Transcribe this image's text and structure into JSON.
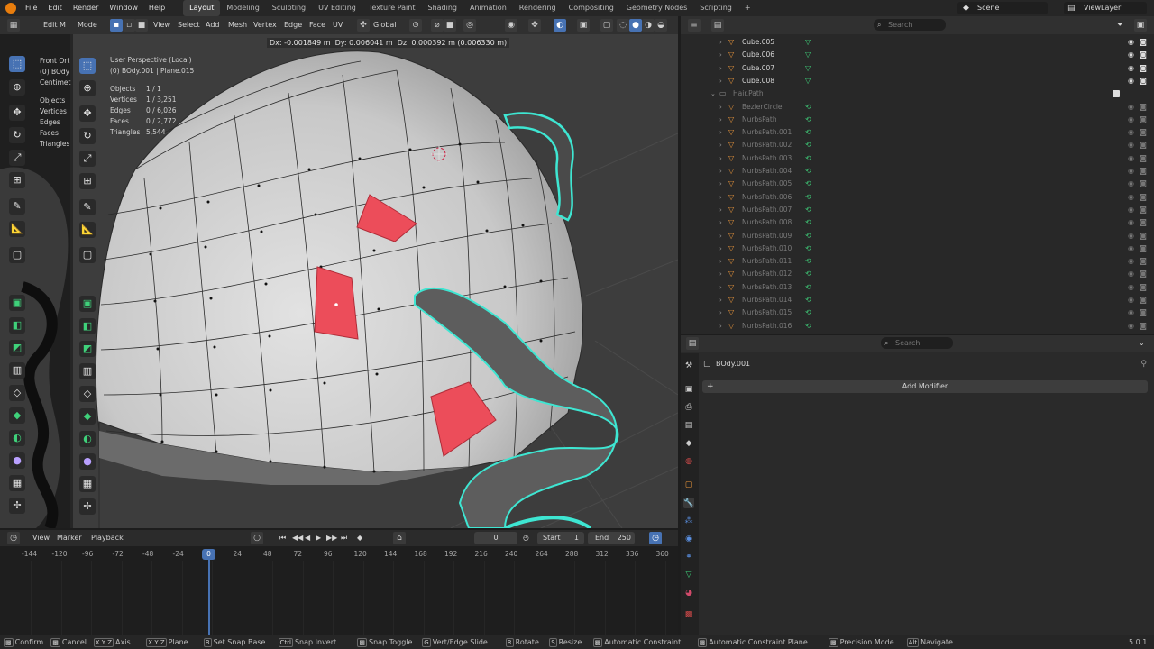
{
  "app": {
    "version": "5.0.1"
  },
  "menu": [
    "File",
    "Edit",
    "Render",
    "Window",
    "Help"
  ],
  "workspaces": [
    "Layout",
    "Modeling",
    "Sculpting",
    "UV Editing",
    "Texture Paint",
    "Shading",
    "Animation",
    "Rendering",
    "Compositing",
    "Geometry Nodes",
    "Scripting"
  ],
  "active_workspace": "Layout",
  "scene": {
    "name": "Scene",
    "view_layer": "ViewLayer"
  },
  "viewport_header": {
    "mode_left": "Edit M",
    "mode_label": "Mode",
    "menus": [
      "View",
      "Select",
      "Add",
      "Mesh",
      "Vertex",
      "Edge",
      "Face",
      "UV"
    ],
    "transform_orientation": "Global"
  },
  "transform_readout": "Dx: -0.001849 m  Dy: 0.006041 m  Dz: 0.000392 m (0.006330 m)",
  "left_view": {
    "view": "Front Ort",
    "object": "(0) BOdy",
    "units": "Centimet",
    "stats": [
      "Objects",
      "Vertices",
      "Edges",
      "Faces",
      "Triangles"
    ]
  },
  "main_view": {
    "view": "User Perspective (Local)",
    "object": "(0) BOdy.001 | Plane.015",
    "stats": [
      {
        "label": "Objects",
        "value": "1 / 1"
      },
      {
        "label": "Vertices",
        "value": "1 / 3,251"
      },
      {
        "label": "Edges",
        "value": "0 / 6,026"
      },
      {
        "label": "Faces",
        "value": "0 / 2,772"
      },
      {
        "label": "Triangles",
        "value": "5,544"
      }
    ]
  },
  "outliner": {
    "search_placeholder": "Search",
    "items": [
      {
        "name": "Cube.005",
        "dim": false
      },
      {
        "name": "Cube.006",
        "dim": false
      },
      {
        "name": "Cube.007",
        "dim": false
      },
      {
        "name": "Cube.008",
        "dim": false
      },
      {
        "name": "Hair.Path",
        "dim": true
      },
      {
        "name": "BezierCircle",
        "dim": true
      },
      {
        "name": "NurbsPath",
        "dim": true
      },
      {
        "name": "NurbsPath.001",
        "dim": true
      },
      {
        "name": "NurbsPath.002",
        "dim": true
      },
      {
        "name": "NurbsPath.003",
        "dim": true
      },
      {
        "name": "NurbsPath.004",
        "dim": true
      },
      {
        "name": "NurbsPath.005",
        "dim": true
      },
      {
        "name": "NurbsPath.006",
        "dim": true
      },
      {
        "name": "NurbsPath.007",
        "dim": true
      },
      {
        "name": "NurbsPath.008",
        "dim": true
      },
      {
        "name": "NurbsPath.009",
        "dim": true
      },
      {
        "name": "NurbsPath.010",
        "dim": true
      },
      {
        "name": "NurbsPath.011",
        "dim": true
      },
      {
        "name": "NurbsPath.012",
        "dim": true
      },
      {
        "name": "NurbsPath.013",
        "dim": true
      },
      {
        "name": "NurbsPath.014",
        "dim": true
      },
      {
        "name": "NurbsPath.015",
        "dim": true
      },
      {
        "name": "NurbsPath.016",
        "dim": true
      }
    ]
  },
  "properties": {
    "search_placeholder": "Search",
    "object_name": "BOdy.001",
    "add_modifier": "Add Modifier"
  },
  "timeline": {
    "menus": [
      "View",
      "Marker",
      "Playback"
    ],
    "current_frame": "0",
    "start_label": "Start",
    "start": "1",
    "end_label": "End",
    "end": "250",
    "ticks": [
      "-144",
      "-120",
      "-96",
      "-72",
      "-48",
      "-24",
      "0",
      "24",
      "48",
      "72",
      "96",
      "120",
      "144",
      "168",
      "192",
      "216",
      "240",
      "264",
      "288",
      "312",
      "336",
      "360"
    ],
    "playhead_label": "0"
  },
  "statusbar": [
    {
      "key": "",
      "label": "Confirm"
    },
    {
      "key": "",
      "label": "Cancel"
    },
    {
      "key": "X Y Z",
      "label": "Axis"
    },
    {
      "key": "X Y Z",
      "label": "Plane"
    },
    {
      "key": "B",
      "label": "Set Snap Base"
    },
    {
      "key": "Ctrl",
      "label": "Snap Invert"
    },
    {
      "key": "",
      "label": "Snap Toggle"
    },
    {
      "key": "G",
      "label": "Vert/Edge Slide"
    },
    {
      "key": "R",
      "label": "Rotate"
    },
    {
      "key": "S",
      "label": "Resize"
    },
    {
      "key": "",
      "label": "Automatic Constraint"
    },
    {
      "key": "",
      "label": "Automatic Constraint Plane"
    },
    {
      "key": "",
      "label": "Precision Mode"
    },
    {
      "key": "Alt",
      "label": "Navigate"
    }
  ],
  "colors": {
    "accent": "#4772b3",
    "selected_face": "#ec4d5a",
    "hair_wire": "#3ee6d2",
    "mesh": "#c9c9c9"
  }
}
